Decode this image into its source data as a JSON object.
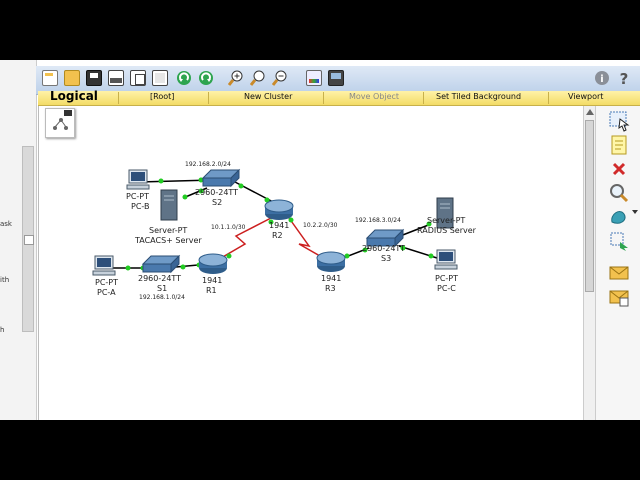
{
  "toolbar": {
    "icons": [
      "new-icon",
      "open-icon",
      "save-icon",
      "print-icon",
      "copy-icon",
      "paste-icon",
      "undo-icon",
      "redo-icon",
      "zoom-in-icon",
      "zoom-reset-icon",
      "zoom-out-icon",
      "palette-icon",
      "device-icon"
    ],
    "info_icon": "info-icon",
    "help_icon": "help-icon"
  },
  "logical_bar": {
    "title": "Logical",
    "root": "[Root]",
    "new_cluster": "New Cluster",
    "move_object": "Move Object",
    "tiled_background": "Set Tiled Background",
    "viewport": "Viewport"
  },
  "left_sidebar": {
    "fragments": [
      "ask",
      "ith",
      "h"
    ]
  },
  "devices": {
    "pc_b": {
      "type": "PC-PT",
      "name": "PC-B"
    },
    "server_tacacs": {
      "type": "Server-PT",
      "name": "TACACS+ Server"
    },
    "s2": {
      "type": "2960-24TT",
      "name": "S2"
    },
    "r2": {
      "type": "1941",
      "name": "R2"
    },
    "pc_a": {
      "type": "PC-PT",
      "name": "PC-A"
    },
    "s1": {
      "type": "2960-24TT",
      "name": "S1"
    },
    "r1": {
      "type": "1941",
      "name": "R1"
    },
    "r3": {
      "type": "1941",
      "name": "R3"
    },
    "s3": {
      "type": "2960-24TT",
      "name": "S3"
    },
    "server_radius": {
      "type": "Server-PT",
      "name": "RADIUS Server"
    },
    "pc_c": {
      "type": "PC-PT",
      "name": "PC-C"
    }
  },
  "networks": {
    "lan2": "192.168.2.0/24",
    "lan1": "192.168.1.0/24",
    "lan3": "192.168.3.0/24",
    "wan1": "10.1.1.0/30",
    "wan2": "10.2.2.0/30"
  },
  "colors": {
    "toolbar": "#c9d9ee",
    "logical_bar": "#f6e38a",
    "link_ethernet": "#000000",
    "link_serial": "#cc1f1f",
    "port_up": "#22cc22"
  }
}
